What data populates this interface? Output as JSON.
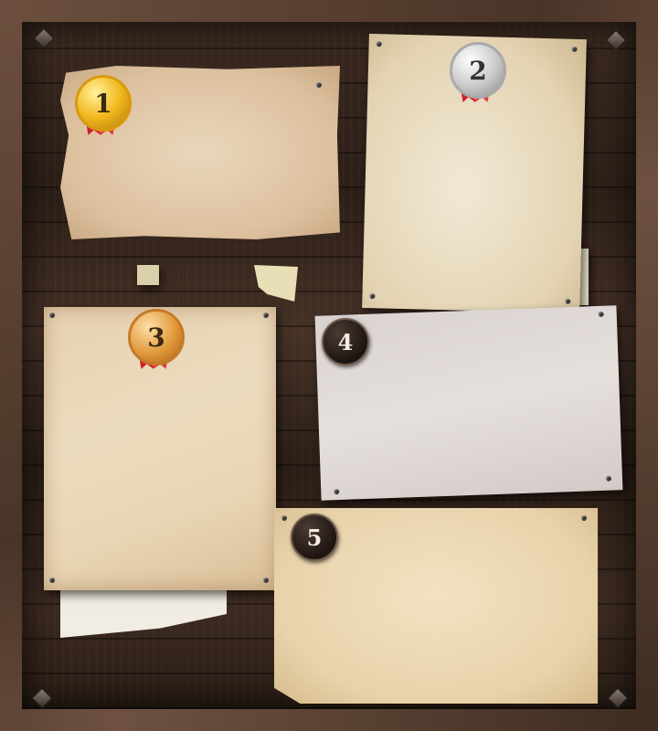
{
  "board": {
    "slots": [
      {
        "id": "slot-1",
        "rank": "1",
        "medal": "gold"
      },
      {
        "id": "slot-2",
        "rank": "2",
        "medal": "silver"
      },
      {
        "id": "slot-3",
        "rank": "3",
        "medal": "bronze"
      },
      {
        "id": "slot-4",
        "rank": "4",
        "medal": "none"
      },
      {
        "id": "slot-5",
        "rank": "5",
        "medal": "none"
      }
    ]
  },
  "colors": {
    "wood_dark": "#2c1f17",
    "frame": "#5c4334",
    "gold": "#f2b81e",
    "silver": "#c8c8c8",
    "bronze": "#e0993a",
    "ribbon": "#d0202a"
  }
}
